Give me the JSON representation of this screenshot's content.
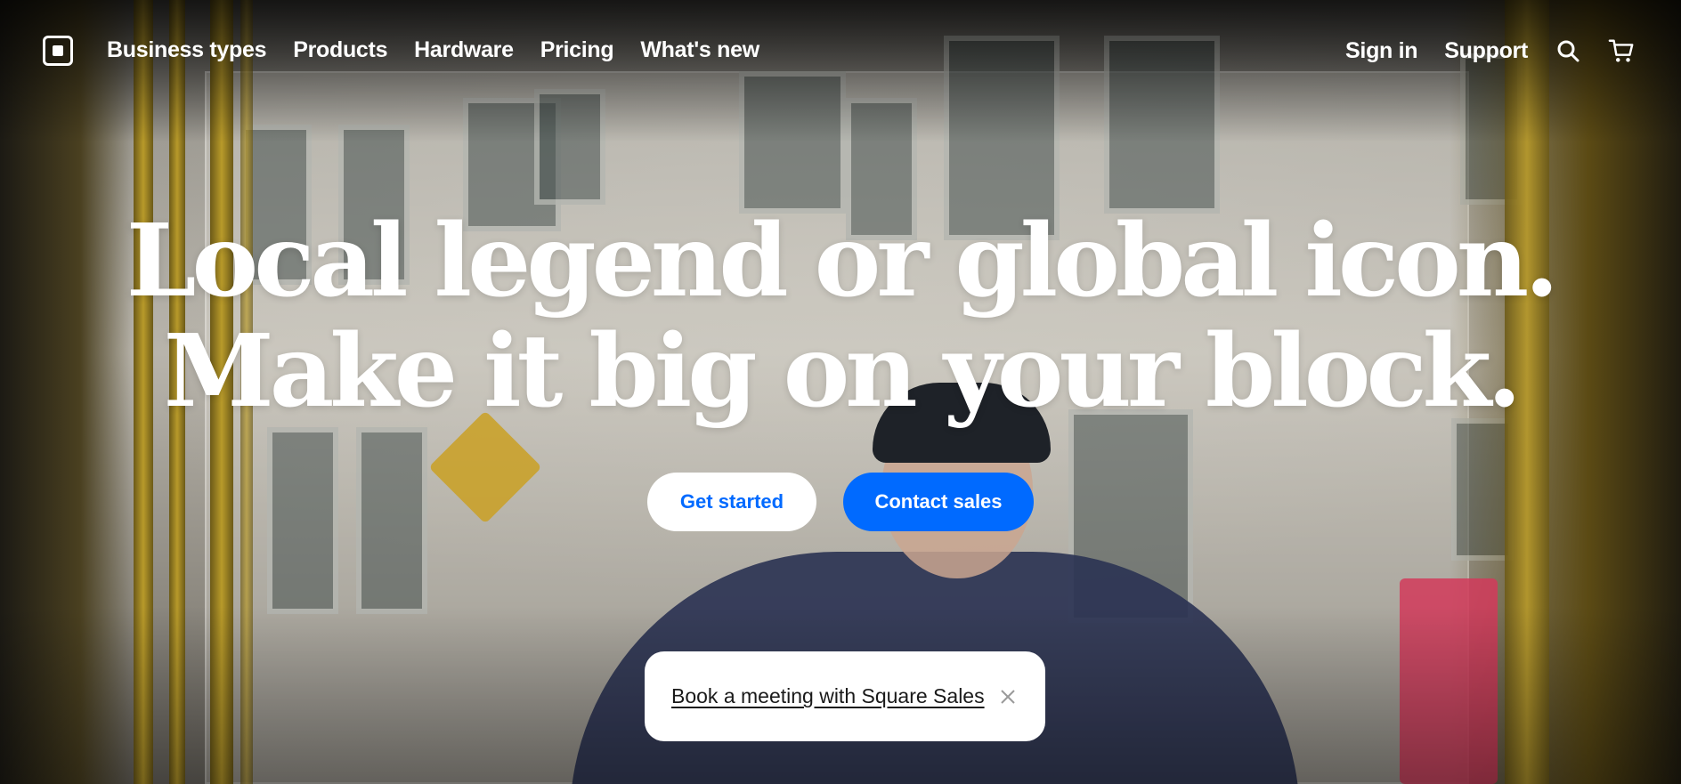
{
  "nav": {
    "logo_icon": "square-logo-icon",
    "links": [
      "Business types",
      "Products",
      "Hardware",
      "Pricing",
      "What's new"
    ],
    "right_links": [
      "Sign in",
      "Support"
    ],
    "search_icon": "search-icon",
    "cart_icon": "cart-icon"
  },
  "hero": {
    "headline_line1": "Local legend or global icon.",
    "headline_line2": "Make it big on your block.",
    "primary_cta": "Get started",
    "secondary_cta": "Contact sales"
  },
  "toast": {
    "link_text": "Book a meeting with Square Sales",
    "close_icon": "close-icon"
  },
  "colors": {
    "accent_blue": "#006aff",
    "text_on_hero": "#ffffff"
  }
}
